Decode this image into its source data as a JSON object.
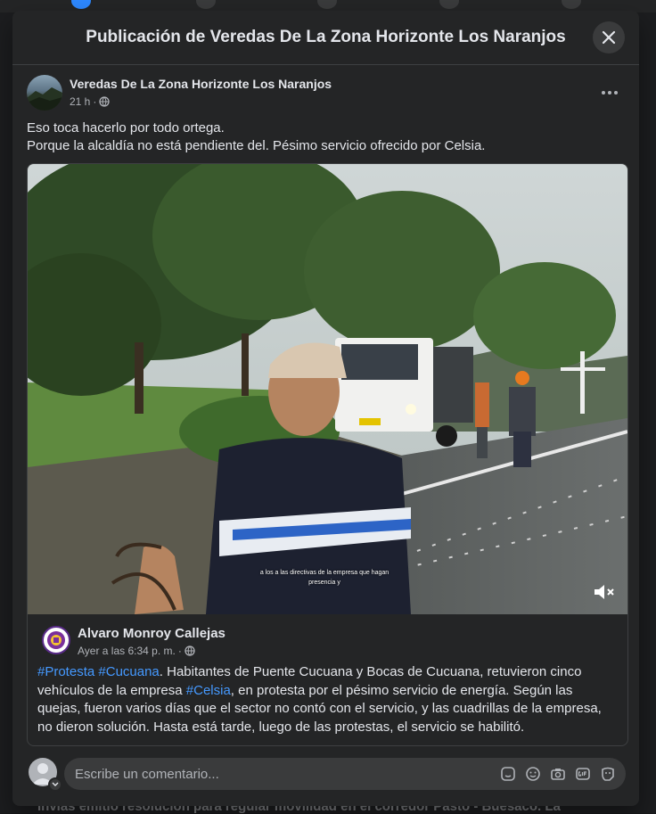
{
  "modal": {
    "title": "Publicación de Veredas De La Zona Horizonte Los Naranjos"
  },
  "post": {
    "author": "Veredas De La Zona Horizonte Los Naranjos",
    "time": "21 h",
    "separator": "·",
    "text_line1": "Eso toca hacerlo por todo ortega.",
    "text_line2": "Porque la alcaldía no está pendiente del. Pésimo servicio ofrecido por Celsia."
  },
  "shared_post": {
    "video_caption": "a los a las directivas de la empresa que hagan presencia y",
    "author": "Alvaro Monroy Callejas",
    "time": "Ayer a las 6:34 p. m.",
    "separator": "·",
    "hashtag1": "#Protesta",
    "hashtag2": "#Cucuana",
    "text_part1": ". Habitantes de Puente Cucuana y Bocas de Cucuana, retuvieron cinco vehículos de la empresa ",
    "hashtag3": "#Celsia",
    "text_part2": ", en protesta por el pésimo servicio de energía. Según las quejas, fueron varios días que el sector no contó con el servicio, y las cuadrillas de la empresa, no dieron solución. Hasta está tarde, luego de las protestas, el servicio se habilitó."
  },
  "comment": {
    "placeholder": "Escribe un comentario...",
    "icons": [
      "sticker-icon",
      "emoji-icon",
      "camera-icon",
      "gif-icon",
      "avatar-sticker-icon"
    ]
  },
  "background": {
    "bottom_text": "Invías emitió resolución para regular movilidad en el corredor Pasto - Buesaco. La"
  },
  "colors": {
    "modal_bg": "#242526",
    "text_primary": "#e4e6eb",
    "text_secondary": "#b0b3b8",
    "hashtag": "#4599ff",
    "input_bg": "#3a3b3c"
  }
}
